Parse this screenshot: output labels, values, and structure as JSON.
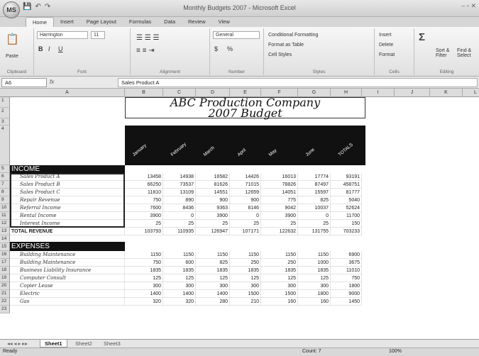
{
  "window": {
    "title": "Monthly Budgets 2007 - Microsoft Excel",
    "office_button": "MS",
    "controls": "–  ▫  ✕"
  },
  "qat": {
    "save": "💾",
    "undo": "↶",
    "redo": "↷"
  },
  "tabs": [
    "Home",
    "Insert",
    "Page Layout",
    "Formulas",
    "Data",
    "Review",
    "View"
  ],
  "ribbon": {
    "clipboard": {
      "label": "Clipboard",
      "paste": "Paste"
    },
    "font": {
      "label": "Font",
      "name": "Harrington",
      "size": "11",
      "bold": "B",
      "italic": "I",
      "underline": "U"
    },
    "alignment": {
      "label": "Alignment"
    },
    "number": {
      "label": "Number",
      "format": "General",
      "currency": "$",
      "percent": "%"
    },
    "styles": {
      "label": "Styles",
      "cond": "Conditional Formatting",
      "table": "Format as Table",
      "cell": "Cell Styles"
    },
    "cells": {
      "label": "Cells",
      "insert": "Insert",
      "delete": "Delete",
      "format": "Format"
    },
    "editing": {
      "label": "Editing",
      "sum": "Σ",
      "sort": "Sort &\nFilter",
      "find": "Find &\nSelect"
    }
  },
  "formula": {
    "namebox": "A6",
    "fx": "fx",
    "content": "Sales Product A"
  },
  "columns": [
    "A",
    "B",
    "C",
    "D",
    "E",
    "F",
    "G",
    "H",
    "I",
    "J",
    "K",
    "L"
  ],
  "sheet": {
    "title1": "ABC Production Company",
    "title2": "2007 Budget",
    "months": [
      "January",
      "February",
      "March",
      "April",
      "May",
      "June",
      "TOTALS"
    ],
    "income_label": "INCOME",
    "income": [
      {
        "name": "Sales Product A",
        "v": [
          "13458",
          "14938",
          "16582",
          "14426",
          "16013",
          "17774",
          "93191"
        ]
      },
      {
        "name": "Sales Product B",
        "v": [
          "66250",
          "73537",
          "81626",
          "71015",
          "78826",
          "87497",
          "458751"
        ]
      },
      {
        "name": "Sales Product C",
        "v": [
          "11810",
          "13109",
          "14551",
          "12659",
          "14051",
          "15597",
          "81777"
        ]
      },
      {
        "name": "Repair Revenue",
        "v": [
          "750",
          "890",
          "900",
          "900",
          "775",
          "825",
          "5040"
        ]
      },
      {
        "name": "Referral Income",
        "v": [
          "7600",
          "8436",
          "9363",
          "8146",
          "9042",
          "10037",
          "52624"
        ]
      },
      {
        "name": "Rental Income",
        "v": [
          "3900",
          "0",
          "3900",
          "0",
          "3900",
          "0",
          "11700"
        ]
      },
      {
        "name": "Interest Income",
        "v": [
          "25",
          "25",
          "25",
          "25",
          "25",
          "25",
          "150"
        ]
      }
    ],
    "total_revenue": {
      "name": "TOTAL REVENUE",
      "v": [
        "103793",
        "110935",
        "126947",
        "107171",
        "122632",
        "131755",
        "703233"
      ]
    },
    "expenses_label": "EXPENSES",
    "expenses": [
      {
        "name": "Building Maintenance",
        "v": [
          "1150",
          "1150",
          "1150",
          "1150",
          "1150",
          "1150",
          "6900"
        ]
      },
      {
        "name": "Building Maintenance",
        "v": [
          "750",
          "600",
          "825",
          "250",
          "250",
          "1000",
          "3675"
        ]
      },
      {
        "name": "Business Liability Insurance",
        "v": [
          "1835",
          "1835",
          "1835",
          "1835",
          "1835",
          "1835",
          "11010"
        ]
      },
      {
        "name": "Computer Consult",
        "v": [
          "125",
          "125",
          "125",
          "125",
          "125",
          "125",
          "750"
        ]
      },
      {
        "name": "Copier Lease",
        "v": [
          "300",
          "300",
          "300",
          "300",
          "300",
          "300",
          "1800"
        ]
      },
      {
        "name": "Electric",
        "v": [
          "1400",
          "1400",
          "1400",
          "1500",
          "1500",
          "1800",
          "9000"
        ]
      },
      {
        "name": "Gas",
        "v": [
          "320",
          "320",
          "280",
          "210",
          "160",
          "160",
          "1450"
        ]
      }
    ]
  },
  "sheet_tabs": [
    "Sheet1",
    "Sheet2",
    "Sheet3"
  ],
  "status": {
    "ready": "Ready",
    "count": "Count: 7",
    "zoom": "100%"
  }
}
